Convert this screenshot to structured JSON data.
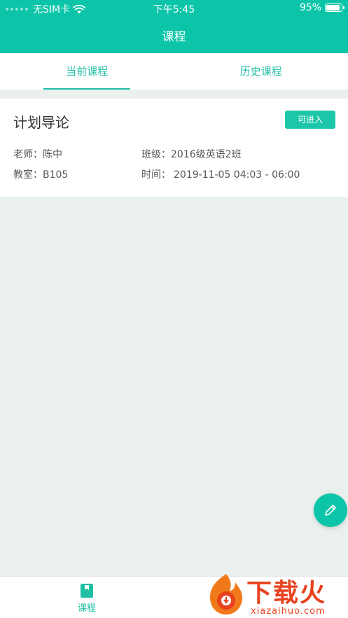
{
  "status_bar": {
    "carrier": "无SIM卡",
    "time": "下午5:45",
    "battery": "95%",
    "battery_level": 0.95
  },
  "nav": {
    "title": "课程"
  },
  "tabs": [
    {
      "label": "当前课程",
      "active": true
    },
    {
      "label": "历史课程",
      "active": false
    }
  ],
  "course": {
    "name": "计划导论",
    "enter_label": "可进入",
    "teacher_label": "老师：",
    "teacher": "陈中",
    "class_label": "班级：",
    "class": "2016级英语2班",
    "room_label": "教室：",
    "room": "B105",
    "time_label": "时间：",
    "time": "2019-11-05 04:03 - 06:00"
  },
  "tabbar": {
    "courses_label": "课程"
  },
  "watermark": {
    "brand": "下载火",
    "domain": "xiazaihuo.com"
  },
  "colors": {
    "accent": "#0cc5a9",
    "background": "#eaf0ee",
    "watermark": "#e8411e"
  }
}
